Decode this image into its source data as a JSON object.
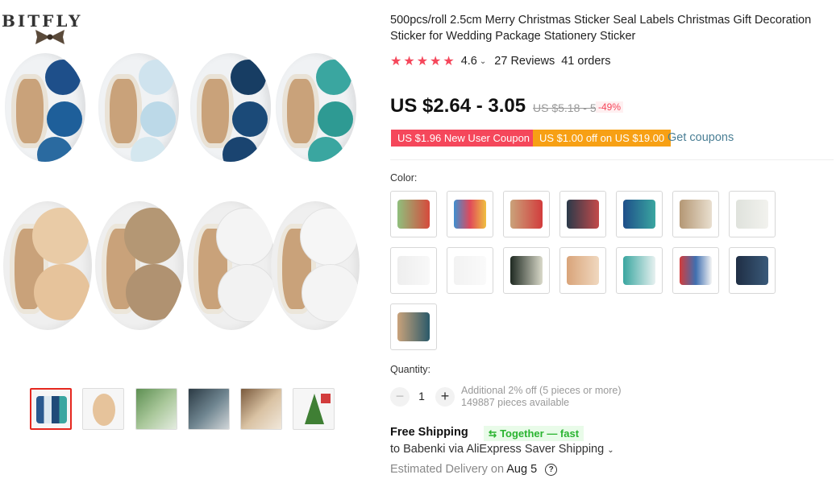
{
  "brand": {
    "name": "BITFLY"
  },
  "product": {
    "title": "500pcs/roll 2.5cm Merry Christmas Sticker Seal Labels Christmas Gift Decoration Sticker for Wedding Package Stationery Sticker",
    "rating": {
      "stars": 5,
      "value": "4.6",
      "reviews": "27 Reviews",
      "orders": "41 orders"
    },
    "price": "US $2.64 - 3.05",
    "old_price": "US $5.18 - 5.98",
    "discount": "-49%"
  },
  "coupons": {
    "new_user": "US $1.96 New User Coupon",
    "store": "US $1.00 off on US $19.00",
    "get_coupons": "Get coupons"
  },
  "color": {
    "label": "Color:",
    "options_count": 15
  },
  "quantity": {
    "label": "Quantity:",
    "minus": "−",
    "value": "1",
    "plus": "+",
    "note": "Additional 2% off (5 pieces or more)",
    "available": "149887 pieces available"
  },
  "shipping": {
    "title": "Free Shipping",
    "badge": "Together — fast",
    "to": "to Babenki via AliExpress Saver Shipping",
    "delivery_prefix": "Estimated Delivery on",
    "delivery_date": "Aug 5"
  },
  "colors": {
    "accent": "#f5475b",
    "coupon_orange": "#f7a014",
    "link": "#4a7f95",
    "green_badge": "#2bb431"
  },
  "icons": {
    "star": "★",
    "chevron": "⌄",
    "help": "?",
    "truck": "⇆"
  }
}
